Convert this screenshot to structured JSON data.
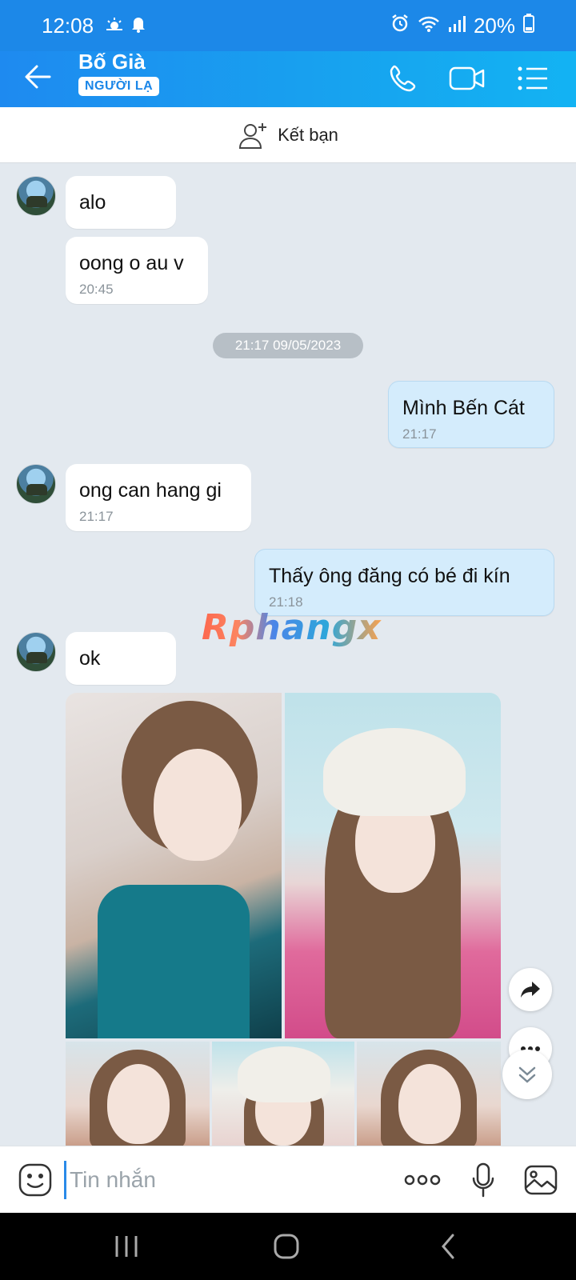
{
  "status_bar": {
    "time": "12:08",
    "battery": "20%"
  },
  "header": {
    "contact_name": "Bố Già",
    "badge": "NGƯỜI LẠ"
  },
  "add_friend": {
    "label": "Kết bạn"
  },
  "date_divider": "21:17 09/05/2023",
  "messages": [
    {
      "sender": "other",
      "text": "alo",
      "time": ""
    },
    {
      "sender": "other",
      "text": "oong o au v",
      "time": "20:45"
    },
    {
      "sender": "me",
      "text": "Mình Bến Cát",
      "time": "21:17"
    },
    {
      "sender": "other",
      "text": "ong can hang gi",
      "time": "21:17"
    },
    {
      "sender": "me",
      "text": "Thấy ông đăng có bé đi kín",
      "time": "21:18"
    },
    {
      "sender": "other",
      "text": "ok",
      "time": ""
    }
  ],
  "watermark": "Rphangx",
  "input": {
    "placeholder": "Tin nhắn"
  },
  "icons": {
    "status": [
      "weather-icon",
      "notification-bell-icon",
      "alarm-icon",
      "wifi-icon",
      "signal-icon",
      "battery-icon"
    ],
    "header": [
      "back-arrow-icon",
      "phone-icon",
      "video-camera-icon",
      "menu-list-icon"
    ],
    "input_bar": [
      "emoji-icon",
      "more-dots-icon",
      "microphone-icon",
      "image-gallery-icon"
    ],
    "nav_bar": [
      "recents-icon",
      "home-icon",
      "back-icon"
    ]
  },
  "colors": {
    "header": "#1e8af0",
    "my_bubble": "#d4ecfc",
    "chat_bg": "#e3e9ef"
  }
}
